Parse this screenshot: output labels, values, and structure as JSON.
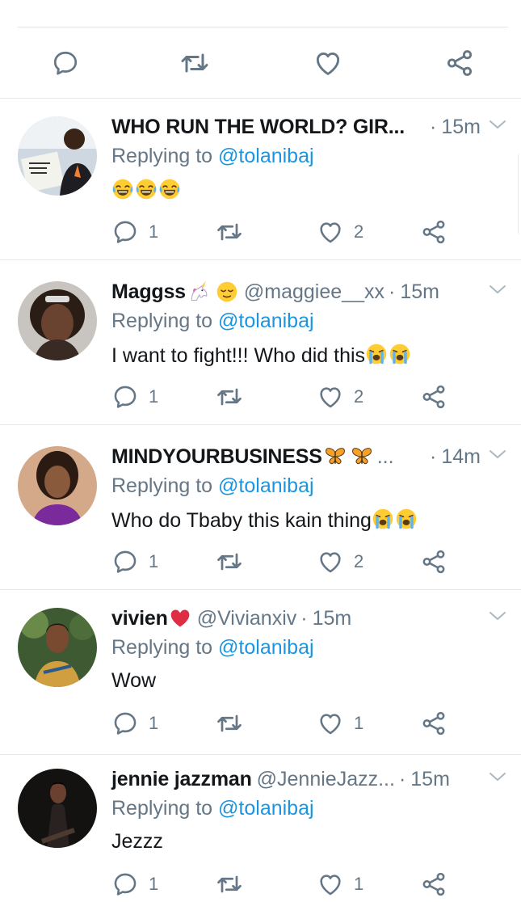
{
  "colors": {
    "link": "#1b95e0",
    "meta": "#657786",
    "text": "#14171a",
    "icon": "#657786",
    "separator": "#e1e8ed"
  },
  "top_actions": [
    "reply-icon",
    "retweet-icon",
    "like-icon",
    "share-icon"
  ],
  "tweets": [
    {
      "name": "WHO RUN THE WORLD? GIR...",
      "name_emoji": [],
      "handle": "",
      "time": "15m",
      "replying_label": "Replying to",
      "reply_to": "@tolanibaj",
      "text": "",
      "text_emoji": [
        "face-with-tears-of-joy",
        "face-with-tears-of-joy",
        "face-with-tears-of-joy"
      ],
      "replies": "1",
      "retweets": "",
      "likes": "2"
    },
    {
      "name": "Maggss",
      "name_emoji": [
        "unicorn",
        "relieved-face"
      ],
      "handle": "@maggiee__xx",
      "time": "15m",
      "replying_label": "Replying to",
      "reply_to": "@tolanibaj",
      "text": "I want to fight!!! Who did this",
      "text_emoji": [
        "loudly-crying-face",
        "loudly-crying-face"
      ],
      "replies": "1",
      "retweets": "",
      "likes": "2"
    },
    {
      "name": "MINDYOURBUSINESS",
      "name_emoji": [
        "butterfly",
        "butterfly"
      ],
      "name_suffix": "...",
      "handle": "",
      "time": "14m",
      "replying_label": "Replying to",
      "reply_to": "@tolanibaj",
      "text": "Who do Tbaby this kain thing",
      "text_emoji": [
        "loudly-crying-face",
        "loudly-crying-face"
      ],
      "replies": "1",
      "retweets": "",
      "likes": "2"
    },
    {
      "name": "vivien",
      "name_emoji": [
        "red-heart"
      ],
      "handle": "@Vivianxiv",
      "time": "15m",
      "replying_label": "Replying to",
      "reply_to": "@tolanibaj",
      "text": "Wow",
      "text_emoji": [],
      "replies": "1",
      "retweets": "",
      "likes": "1"
    },
    {
      "name": "jennie jazzman",
      "name_emoji": [],
      "handle": "@JennieJazz...",
      "time": "15m",
      "replying_label": "Replying to",
      "reply_to": "@tolanibaj",
      "text": "Jezzz",
      "text_emoji": [],
      "replies": "1",
      "retweets": "",
      "likes": "1"
    }
  ]
}
